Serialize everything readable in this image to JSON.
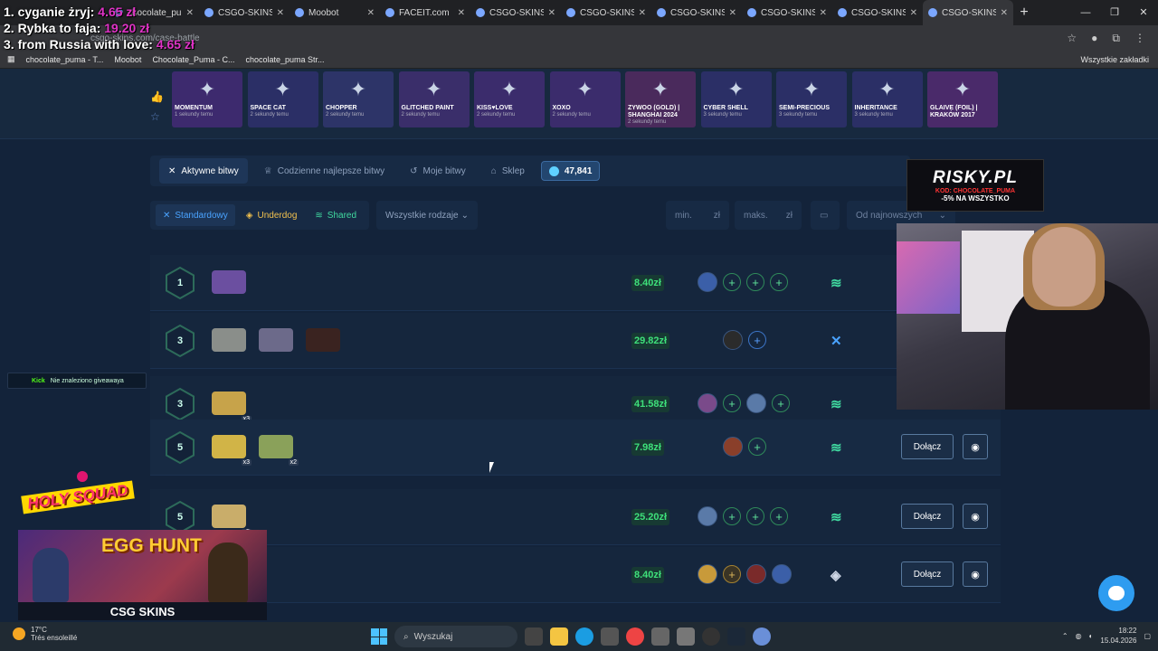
{
  "overlay": {
    "lines": [
      {
        "text": "1. cyganie żryj:",
        "amount": "4.65 zł"
      },
      {
        "text": "2. Rybka to faja:",
        "amount": "19.20 zł"
      },
      {
        "text": "3. from Russia with love:",
        "amount": "4.65 zł"
      }
    ]
  },
  "browser": {
    "tabs": [
      "chocolate_puma",
      "CSGO-SKINS.C",
      "Moobot",
      "FACEIT.com",
      "CSGO-SKINS.C",
      "CSGO-SKINS.C",
      "CSGO-SKINS.C",
      "CSGO-SKINS.C",
      "CSGO-SKINS.C",
      "CSGO-SKINS.C"
    ],
    "url": "csgo-skins.com/case-battle",
    "bookmarks": [
      "chocolate_puma - T...",
      "Moobot",
      "Chocolate_Puma - C...",
      "chocolate_puma Str..."
    ],
    "bookmarks_right": "Wszystkie zakładki"
  },
  "drops": [
    {
      "name": "MOMENTUM",
      "time": "1 sekundy temu",
      "color": "#3d2a6e"
    },
    {
      "name": "SPACE CAT",
      "time": "2 sekundy temu",
      "color": "#2b2f66"
    },
    {
      "name": "CHOPPER",
      "time": "2 sekundy temu",
      "color": "#2d3468"
    },
    {
      "name": "GLITCHED PAINT",
      "time": "2 sekundy temu",
      "color": "#3a2e6a"
    },
    {
      "name": "KISS♥LOVE",
      "time": "2 sekundy temu",
      "color": "#3b2c6c"
    },
    {
      "name": "XOXO",
      "time": "2 sekundy temu",
      "color": "#3b2c6c"
    },
    {
      "name": "ZYWOO (GOLD) | SHANGHAI 2024",
      "time": "2 sekundy temu",
      "color": "#4a2a5c"
    },
    {
      "name": "CYBER SHELL",
      "time": "3 sekundy temu",
      "color": "#2b2f66"
    },
    {
      "name": "SEMI-PRECIOUS",
      "time": "3 sekundy temu",
      "color": "#2b2f66"
    },
    {
      "name": "INHERITANCE",
      "time": "3 sekundy temu",
      "color": "#2b2f66"
    },
    {
      "name": "GLAIVE (FOIL) | KRAKÓW 2017",
      "time": "",
      "color": "#4a2a6a"
    }
  ],
  "nav": {
    "tabs": [
      "Aktywne bitwy",
      "Codzienne najlepsze bitwy",
      "Moje bitwy",
      "Sklep"
    ],
    "balance": "47,841"
  },
  "filters": {
    "standard": "Standardowy",
    "underdog": "Underdog",
    "shared": "Shared",
    "types": "Wszystkie rodzaje",
    "min": "min.",
    "max": "maks.",
    "currency": "zł",
    "sort": "Od najnowszych"
  },
  "battles": [
    {
      "round": "1",
      "price": "8.40zł",
      "cases": [
        {
          "color": "#6b4fa0",
          "count": ""
        }
      ],
      "mode": "≋",
      "mode_color": "#40d9a0",
      "join": "",
      "players": [
        "av",
        "+",
        "+",
        "+"
      ]
    },
    {
      "round": "3",
      "price": "29.82zł",
      "cases": [
        {
          "color": "#8a8e8a",
          "count": ""
        },
        {
          "color": "#6c6a8a",
          "count": ""
        },
        {
          "color": "#3a2320",
          "count": ""
        }
      ],
      "mode": "✕",
      "mode_color": "#4aa3ff",
      "join": "",
      "players": [
        "av",
        "+b"
      ]
    },
    {
      "round": "3",
      "price": "41.58zł",
      "cases": [
        {
          "color": "#c7a34a",
          "count": "x3"
        }
      ],
      "mode": "≋",
      "mode_color": "#40d9a0",
      "join": "",
      "players": [
        "av",
        "+",
        "av",
        "+"
      ]
    },
    {
      "round": "5",
      "price": "7.98zł",
      "cases": [
        {
          "color": "#d1b447",
          "count": "x3"
        },
        {
          "color": "#8aa15a",
          "count": "x2"
        }
      ],
      "mode": "≋",
      "mode_color": "#40d9a0",
      "join": "Dołącz",
      "players": [
        "av",
        "+"
      ]
    },
    {
      "round": "5",
      "price": "25.20zł",
      "cases": [
        {
          "color": "#c9ad6a",
          "count": "x5"
        }
      ],
      "mode": "≋",
      "mode_color": "#40d9a0",
      "join": "Dołącz",
      "players": [
        "av",
        "+",
        "+",
        "+"
      ]
    },
    {
      "round": "",
      "price": "8.40zł",
      "cases": [],
      "mode": "◈",
      "mode_color": "#cfd7e6",
      "join": "Dołącz",
      "players": [
        "av",
        "+g",
        "av",
        "av"
      ]
    }
  ],
  "kick": {
    "label": "Kick",
    "text": "Nie znaleziono giveawaya"
  },
  "holy": "HOLY SQUAD",
  "promo": {
    "title": "EGG HUNT",
    "logo": "CSG SKINS"
  },
  "risky": {
    "brand": "RISKY.PL",
    "code": "KOD: CHOCOLATE_PUMA",
    "discount": "-5% NA WSZYSTKO"
  },
  "taskbar": {
    "temp": "17°C",
    "weather": "Trés ensoleillé",
    "search": "Wyszukaj",
    "time": "18:22",
    "date": "15.04.2026"
  }
}
